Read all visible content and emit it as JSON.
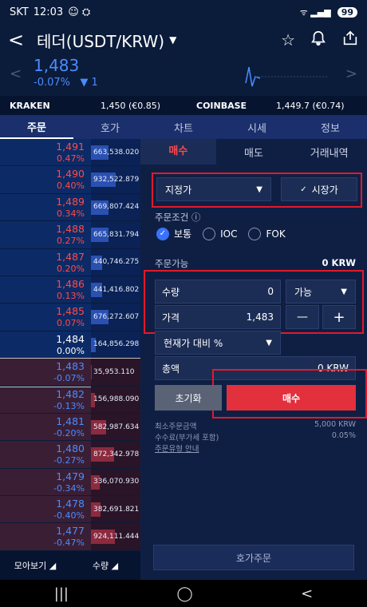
{
  "status": {
    "carrier": "SKT",
    "time": "12:03",
    "notif": "☺ ⛭",
    "signal": "ᯤ ▂▄▆",
    "battery": "99"
  },
  "header": {
    "back_icon": "back-arrow-icon",
    "title": "테더(USDT/KRW)",
    "star_icon": "star-icon",
    "bell_icon": "bell-icon",
    "share_icon": "share-icon"
  },
  "ticker": {
    "price": "1,483",
    "change_pct": "-0.07%",
    "change_abs": "▼ 1",
    "down_color": "#4a8cff"
  },
  "exchanges": {
    "ex1_name": "KRAKEN",
    "ex1_val": "1,450 (€0.85)",
    "ex2_name": "COINBASE",
    "ex2_val": "1,449.7 (€0.74)"
  },
  "tabs": [
    "주문",
    "호가",
    "차트",
    "시세",
    "정보"
  ],
  "orderbook": {
    "rows": [
      {
        "price": "1,491",
        "pct": "0.47%",
        "vol": "663,538.020",
        "side": "sell",
        "fill": 0.35
      },
      {
        "price": "1,490",
        "pct": "0.40%",
        "vol": "932,522.879",
        "side": "sell",
        "fill": 0.5
      },
      {
        "price": "1,489",
        "pct": "0.34%",
        "vol": "669,807.424",
        "side": "sell",
        "fill": 0.35
      },
      {
        "price": "1,488",
        "pct": "0.27%",
        "vol": "665,831.794",
        "side": "sell",
        "fill": 0.35
      },
      {
        "price": "1,487",
        "pct": "0.20%",
        "vol": "440,746.275",
        "side": "sell",
        "fill": 0.23
      },
      {
        "price": "1,486",
        "pct": "0.13%",
        "vol": "441,416.802",
        "side": "sell",
        "fill": 0.23
      },
      {
        "price": "1,485",
        "pct": "0.07%",
        "vol": "676,272.607",
        "side": "sell",
        "fill": 0.36
      },
      {
        "price": "1,484",
        "pct": "0.00%",
        "vol": "164,856.298",
        "side": "sell",
        "fill": 0.09
      },
      {
        "price": "1,483",
        "pct": "-0.07%",
        "vol": "35,953.110",
        "side": "buy",
        "fill": 0.02
      },
      {
        "price": "1,482",
        "pct": "-0.13%",
        "vol": "156,988.090",
        "side": "buy",
        "fill": 0.08
      },
      {
        "price": "1,481",
        "pct": "-0.20%",
        "vol": "582,987.634",
        "side": "buy",
        "fill": 0.31
      },
      {
        "price": "1,480",
        "pct": "-0.27%",
        "vol": "872,342.978",
        "side": "buy",
        "fill": 0.46
      },
      {
        "price": "1,479",
        "pct": "-0.34%",
        "vol": "336,070.930",
        "side": "buy",
        "fill": 0.18
      },
      {
        "price": "1,478",
        "pct": "-0.40%",
        "vol": "382,691.821",
        "side": "buy",
        "fill": 0.2
      },
      {
        "price": "1,477",
        "pct": "-0.47%",
        "vol": "924,111.444",
        "side": "buy",
        "fill": 0.49
      }
    ],
    "up_color": "#ff4a4a",
    "down_color": "#4a8cff",
    "flat_color": "#ffffff"
  },
  "ob_footer": {
    "view": "모아보기 ◢",
    "qty": "수량 ◢"
  },
  "order": {
    "tabs": [
      "매수",
      "매도",
      "거래내역"
    ],
    "type_label": "지정가",
    "market_label": "시장가",
    "cond_label": "주문조건 ⓘ",
    "options": [
      "보통",
      "IOC",
      "FOK"
    ],
    "avail_label": "주문가능",
    "avail_value": "0 KRW",
    "qty_label": "수량",
    "qty_value": "0",
    "qty_option": "가능",
    "price_label": "가격",
    "price_value": "1,483",
    "minus": "—",
    "plus": "+",
    "ratio_label": "현재가 대비 %",
    "total_label": "총액",
    "total_value": "0 KRW",
    "reset_label": "초기화",
    "buy_label": "매수",
    "min_label": "최소주문금액",
    "min_value": "5,000 KRW",
    "fee_label": "수수료(부가세 포함)",
    "fee_value": "0.05%",
    "guide_label": "주문유형 안내",
    "hoga_label": "호가주문"
  },
  "nav": {
    "recent": "|||",
    "home": "◯",
    "back": "<"
  },
  "colors": {
    "accent_red": "#e2192a",
    "buy_btn": "#e2303c",
    "reset_btn": "#5a6276"
  }
}
